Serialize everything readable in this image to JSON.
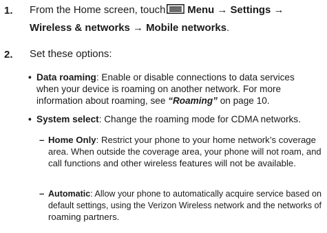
{
  "steps": [
    {
      "number": "1.",
      "line1_pre": "From the Home screen, touch",
      "menu_icon": "menu-icon",
      "line1_menu": "Menu",
      "arrow": "→",
      "line1_settings": "Settings",
      "line2_wireless": "Wireless & networks",
      "line2_mobile": "Mobile networks",
      "line2_end": "."
    },
    {
      "number": "2.",
      "text": "Set these options:"
    }
  ],
  "options": [
    {
      "term": "Data roaming",
      "lines": [
        ": Enable or disable connections to data services",
        "when your device is roaming on another network. For more",
        "information about roaming, see "
      ],
      "ref": "“Roaming”",
      "ref_tail": " on page 10."
    },
    {
      "term": "System select",
      "line": ": Change the roaming mode for CDMA networks."
    }
  ],
  "sub_options": [
    {
      "term": "Home Only",
      "lines": [
        ": Restrict your phone to your home network’s coverage",
        "area. When outside the coverage area, your phone will not roam, and",
        "call functions and other wireless features will not be available."
      ]
    },
    {
      "term": "Automatic",
      "lines": [
        ": Allow your phone to automatically acquire service based on",
        "default settings, using the Verizon Wireless network and the networks of",
        "roaming partners."
      ]
    }
  ],
  "bullet_symbol": "•",
  "dash_symbol": "–"
}
